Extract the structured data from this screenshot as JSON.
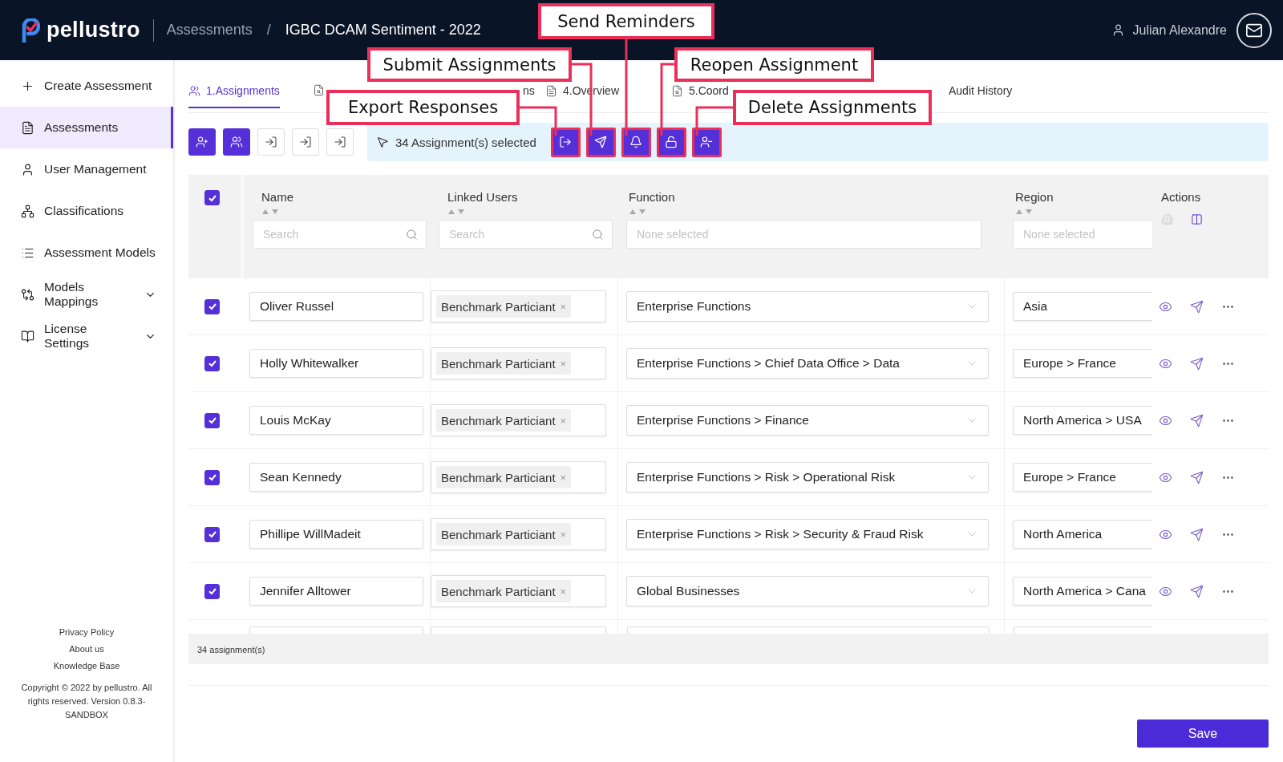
{
  "header": {
    "logo": "pellustro",
    "breadcrumb": [
      "Assessments",
      "IGBC DCAM Sentiment - 2022"
    ],
    "separator": "/",
    "user": "Julian Alexandre"
  },
  "sidebar": {
    "items": [
      {
        "label": "Create Assessment",
        "kind": "link",
        "selected": false
      },
      {
        "label": "Assessments",
        "kind": "link",
        "selected": true
      },
      {
        "label": "User Management",
        "kind": "link",
        "selected": false
      },
      {
        "label": "Classifications",
        "kind": "link",
        "selected": false
      },
      {
        "label": "Assessment Models",
        "kind": "link",
        "selected": false
      },
      {
        "label": "Models Mappings",
        "kind": "group",
        "selected": false
      },
      {
        "label": "License Settings",
        "kind": "group",
        "selected": false
      }
    ],
    "footer_links": [
      "Privacy Policy",
      "About us",
      "Knowledge Base"
    ],
    "copyright": "Copyright © 2022 by pellustro. All rights reserved. Version 0.8.3-SANDBOX"
  },
  "tabs": [
    {
      "label": "1.Assignments",
      "selected": true
    },
    {
      "selected": false
    },
    {
      "label": "ns",
      "selected": false
    },
    {
      "label": "4.Overview",
      "selected": false
    },
    {
      "label": "5.Coord",
      "selected": false
    },
    {
      "label": "Audit History",
      "selected": false
    }
  ],
  "toolbar": {
    "buttons": [
      {
        "kind": "filled"
      },
      {
        "kind": "filled"
      },
      {
        "kind": "outline"
      },
      {
        "kind": "outline"
      },
      {
        "kind": "outline"
      }
    ],
    "selection": {
      "text": "34 Assignment(s) selected",
      "actions": [
        {
          "highlighted": true
        },
        {
          "highlighted": true
        },
        {
          "highlighted": true
        },
        {
          "highlighted": true
        },
        {
          "highlighted": true
        }
      ]
    }
  },
  "table": {
    "select_all": {
      "checked": true
    },
    "columns": [
      {
        "label": "Name",
        "sortable": true,
        "filter": {
          "kind": "search",
          "placeholder": "Search"
        }
      },
      {
        "label": "Linked Users",
        "sortable": true,
        "filter": {
          "kind": "search",
          "placeholder": "Search"
        }
      },
      {
        "label": "Function",
        "sortable": true,
        "filter": {
          "kind": "select",
          "placeholder": "None selected"
        }
      },
      {
        "label": "Region",
        "sortable": true,
        "filter": {
          "kind": "select",
          "placeholder": "None selected"
        }
      },
      {
        "label": "Actions",
        "sortable": false
      }
    ],
    "rows": [
      {
        "checked": true,
        "name": "Oliver Russel",
        "linked_users": [
          {
            "label": "Benchmark Particiant",
            "remove": "×"
          }
        ],
        "function": "Enterprise Functions",
        "region": "Asia"
      },
      {
        "checked": true,
        "name": "Holly Whitewalker",
        "linked_users": [
          {
            "label": "Benchmark Particiant",
            "remove": "×"
          }
        ],
        "function": "Enterprise Functions > Chief Data Office > Data",
        "region": "Europe > France"
      },
      {
        "checked": true,
        "name": "Louis McKay",
        "linked_users": [
          {
            "label": "Benchmark Particiant",
            "remove": "×"
          }
        ],
        "function": "Enterprise Functions > Finance",
        "region": "North America > USA"
      },
      {
        "checked": true,
        "name": "Sean Kennedy",
        "linked_users": [
          {
            "label": "Benchmark Particiant",
            "remove": "×"
          }
        ],
        "function": "Enterprise Functions > Risk > Operational Risk",
        "region": "Europe > France"
      },
      {
        "checked": true,
        "name": "Phillipe WillMadeit",
        "linked_users": [
          {
            "label": "Benchmark Particiant",
            "remove": "×"
          }
        ],
        "function": "Enterprise Functions > Risk > Security & Fraud Risk",
        "region": "North America"
      },
      {
        "checked": true,
        "name": "Jennifer Alltower",
        "linked_users": [
          {
            "label": "Benchmark Particiant",
            "remove": "×"
          }
        ],
        "function": "Global Businesses",
        "region": "North America > Cana"
      }
    ],
    "footer": "34 assignment(s)"
  },
  "save": "Save",
  "callouts": [
    {
      "text": "Send Reminders"
    },
    {
      "text": "Submit Assignments"
    },
    {
      "text": "Reopen Assignment"
    },
    {
      "text": "Export Responses"
    },
    {
      "text": "Delete Assignments"
    }
  ]
}
